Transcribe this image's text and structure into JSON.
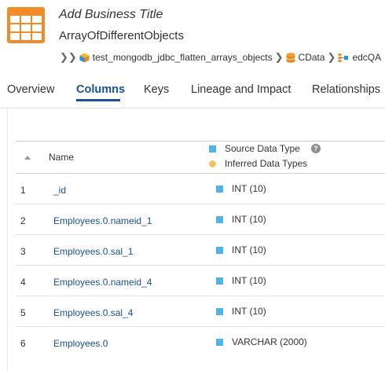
{
  "header": {
    "business_title": "Add Business Title",
    "object_name": "ArrayOfDifferentObjects",
    "breadcrumb": [
      {
        "label": "test_mongodb_jdbc_flatten_arrays_objects",
        "icon": "cube-icon"
      },
      {
        "label": "CData",
        "icon": "database-icon"
      },
      {
        "label": "edcQA",
        "icon": "schema-icon"
      }
    ]
  },
  "tabs": [
    {
      "label": "Overview",
      "active": false
    },
    {
      "label": "Columns",
      "active": true
    },
    {
      "label": "Keys",
      "active": false
    },
    {
      "label": "Lineage and Impact",
      "active": false
    },
    {
      "label": "Relationships",
      "active": false
    }
  ],
  "grid": {
    "header": {
      "name": "Name",
      "source_type": "Source Data Type",
      "inferred_types": "Inferred Data Types",
      "help": "?"
    },
    "rows": [
      {
        "num": "1",
        "name": "_id",
        "type": "INT (10)"
      },
      {
        "num": "2",
        "name": "Employees.0.nameid_1",
        "type": "INT (10)"
      },
      {
        "num": "3",
        "name": "Employees.0.sal_1",
        "type": "INT (10)"
      },
      {
        "num": "4",
        "name": "Employees.0.nameid_4",
        "type": "INT (10)"
      },
      {
        "num": "5",
        "name": "Employees.0.sal_4",
        "type": "INT (10)"
      },
      {
        "num": "6",
        "name": "Employees.0",
        "type": "VARCHAR (2000)"
      }
    ]
  },
  "colors": {
    "brand_orange": "#f28c28",
    "link_blue": "#1a4f9c",
    "source_type_blue": "#4fb3ec",
    "inferred_orange": "#f5c06a"
  }
}
